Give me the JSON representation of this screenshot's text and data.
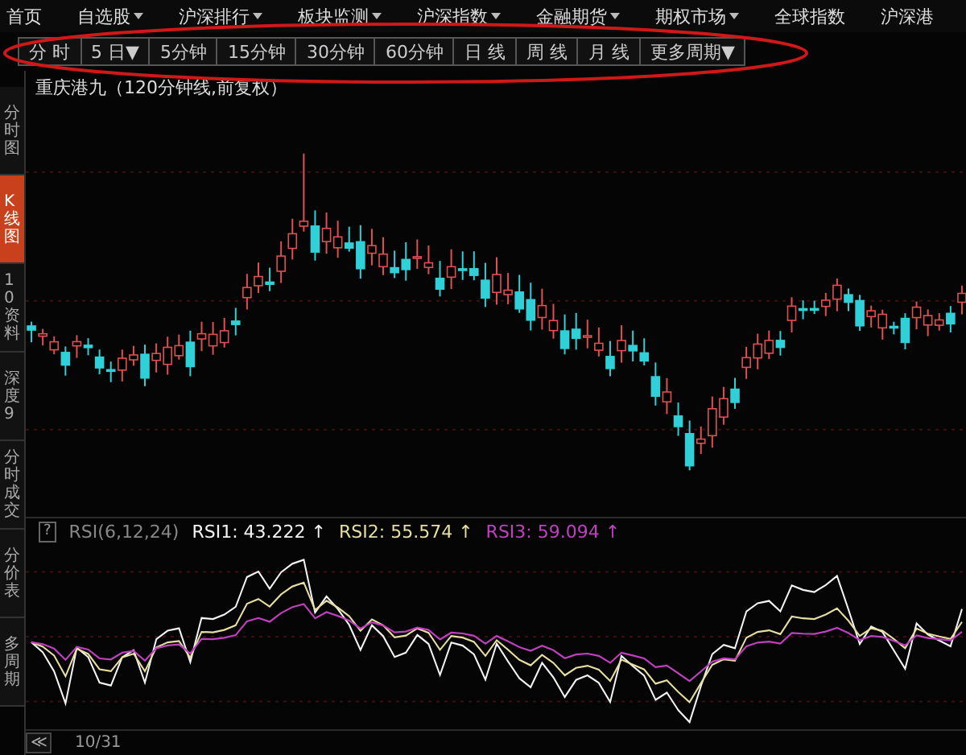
{
  "menu": [
    {
      "label": "首页",
      "dropdown": false
    },
    {
      "label": "自选股",
      "dropdown": true
    },
    {
      "label": "沪深排行",
      "dropdown": true
    },
    {
      "label": "板块监测",
      "dropdown": true
    },
    {
      "label": "沪深指数",
      "dropdown": true
    },
    {
      "label": "金融期货",
      "dropdown": true
    },
    {
      "label": "期权市场",
      "dropdown": true
    },
    {
      "label": "全球指数",
      "dropdown": false
    },
    {
      "label": "沪深港",
      "dropdown": false
    }
  ],
  "periods": [
    {
      "label": "分 时",
      "selected": false
    },
    {
      "label": "5 日▼",
      "selected": false
    },
    {
      "label": "5分钟",
      "selected": false
    },
    {
      "label": "15分钟",
      "selected": false
    },
    {
      "label": "30分钟",
      "selected": false
    },
    {
      "label": "60分钟",
      "selected": false
    },
    {
      "label": "日 线",
      "selected": false
    },
    {
      "label": "周 线",
      "selected": false
    },
    {
      "label": "月 线",
      "selected": false
    },
    {
      "label": "更多周期▼",
      "selected": false
    }
  ],
  "sidebar": [
    {
      "label": "分时图",
      "selected": false
    },
    {
      "label": "K线图",
      "selected": true
    },
    {
      "label": "10资料",
      "selected": false
    },
    {
      "label": "深度9",
      "selected": false
    },
    {
      "label": "分时成交",
      "selected": false
    },
    {
      "label": "分价表",
      "selected": false
    },
    {
      "label": "多周期",
      "selected": false
    }
  ],
  "chart_title": "重庆港九（120分钟线,前复权）",
  "indicator": {
    "help": "?",
    "name": "RSI(6,12,24)",
    "series": [
      {
        "label": "RSI1: 43.222 ↑",
        "color": "#f4f4f4"
      },
      {
        "label": "RSI2: 55.574 ↑",
        "color": "#e6dfa0"
      },
      {
        "label": "RSI3: 59.094 ↑",
        "color": "#c040c0"
      }
    ]
  },
  "footer": {
    "scroll": "≪",
    "date": "10/31"
  }
}
